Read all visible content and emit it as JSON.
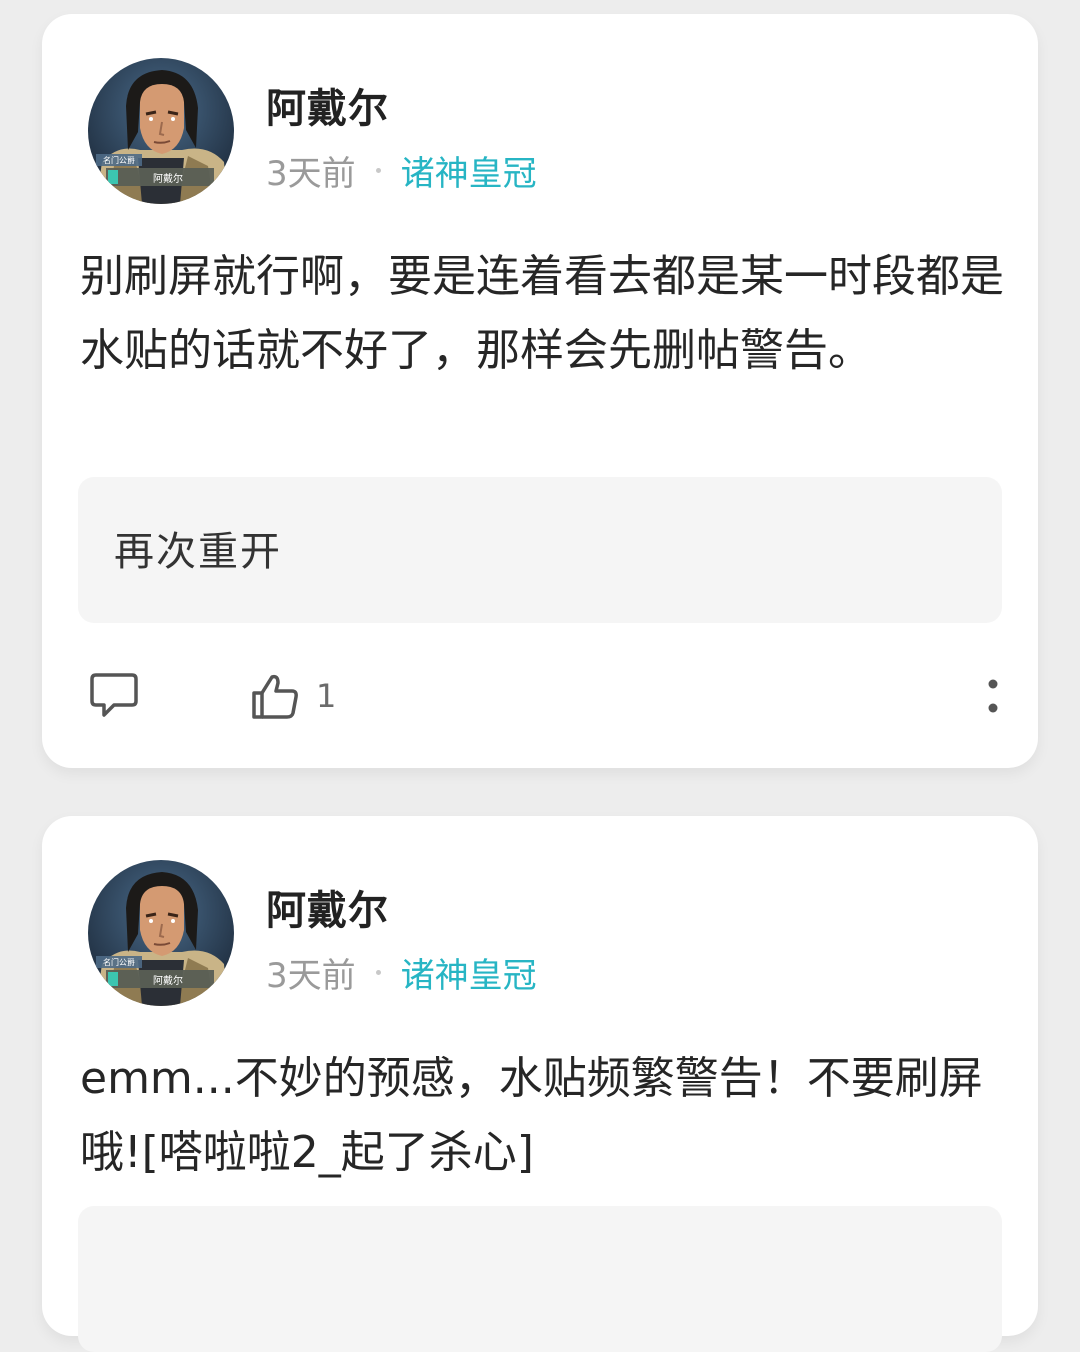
{
  "posts": [
    {
      "author": "阿戴尔",
      "avatar_text": "阿戴尔",
      "avatar_badge": "名门公爵",
      "time": "3天前",
      "tag": "诸神皇冠",
      "content": "别刷屏就行啊，要是连着看去都是某一时段都是水贴的话就不好了，那样会先删帖警告。",
      "quote": "再次重开",
      "like_count": "1"
    },
    {
      "author": "阿戴尔",
      "avatar_text": "阿戴尔",
      "avatar_badge": "名门公爵",
      "time": "3天前",
      "tag": "诸神皇冠",
      "content": "emm...不妙的预感，水贴频繁警告！不要刷屏哦![嗒啦啦2_起了杀心]"
    }
  ],
  "colors": {
    "background": "#ededed",
    "card": "#ffffff",
    "tag": "#27b5c4",
    "quote_bg": "#f5f5f5"
  },
  "icons": [
    "comment-icon",
    "thumbs-up-icon",
    "more-vertical-icon"
  ]
}
